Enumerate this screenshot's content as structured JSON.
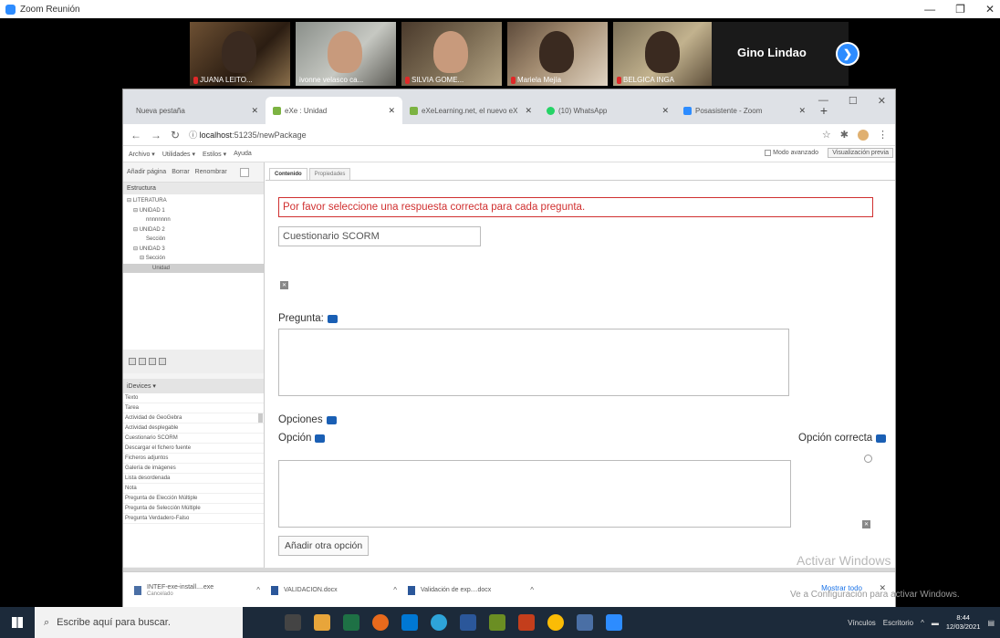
{
  "zoom": {
    "window_title": "Zoom Reunión",
    "participants": [
      {
        "name": "JUANA LEITO..."
      },
      {
        "name": "ivonne velasco ca..."
      },
      {
        "name": "SILVIA GOME..."
      },
      {
        "name": "Mariela Mejía"
      },
      {
        "name": "BELGICA INGA"
      }
    ],
    "speaker_name": "Gino Lindao",
    "next_symbol": "❯"
  },
  "browser": {
    "tabs": [
      {
        "label": "Nueva pestaña"
      },
      {
        "label": "eXe : Unidad"
      },
      {
        "label": "eXeLearning.net, el nuevo eX"
      },
      {
        "label": "(10) WhatsApp"
      },
      {
        "label": "Posasistente - Zoom"
      }
    ],
    "url_host": "localhost",
    "url_rest": ":51235/newPackage"
  },
  "exe": {
    "menu": [
      "Archivo ▾",
      "Utilidades ▾",
      "Estilos ▾",
      "Ayuda"
    ],
    "advanced_mode": "Modo avanzado",
    "preview": "Visualización previa",
    "tree_toolbar": [
      "Añadir página",
      "Borrar",
      "Renombrar"
    ],
    "structure_header": "Estructura",
    "tree": [
      {
        "label": "⊟ LITERATURA",
        "indent": 0
      },
      {
        "label": "⊟ UNIDAD 1",
        "indent": 1
      },
      {
        "label": "nnnnnnnn",
        "indent": 3
      },
      {
        "label": "⊟ UNIDAD 2",
        "indent": 1
      },
      {
        "label": "Sección",
        "indent": 3
      },
      {
        "label": "⊟ UNIDAD 3",
        "indent": 1
      },
      {
        "label": "⊟ Sección",
        "indent": 2
      },
      {
        "label": "Unidad",
        "indent": 4
      }
    ],
    "idevices_header": "iDevices ▾",
    "idevices": [
      "Texto",
      "Tarea",
      "Actividad de GeoGebra",
      "Actividad desplegable",
      "Cuestionario SCORM",
      "Descargar el fichero fuente",
      "Ficheros adjuntos",
      "Galería de imágenes",
      "Lista desordenada",
      "Nota",
      "Pregunta de Elección Múltiple",
      "Pregunta de Selección Múltiple",
      "Pregunta Verdadero-Falso"
    ],
    "content_tabs": [
      "Contenido",
      "Propiedades"
    ],
    "error_message": "Por favor seleccione una respuesta correcta para cada pregunta.",
    "title_value": "Cuestionario SCORM",
    "question_label": "Pregunta:",
    "options_label": "Opciones",
    "option_label": "Opción",
    "correct_option_label": "Opción correcta",
    "add_option": "Añadir otra opción",
    "watermark_title": "Activar Windows",
    "watermark_sub": "Ve a Configuración para activar Windows."
  },
  "downloads": {
    "items": [
      {
        "name": "INTEF-exe-install....exe",
        "status": "Cancelado"
      },
      {
        "name": "VALIDACION.docx",
        "status": ""
      },
      {
        "name": "Validación de exp....docx",
        "status": ""
      }
    ],
    "show_all": "Mostrar todo"
  },
  "taskbar": {
    "search_placeholder": "Escribe aquí para buscar.",
    "tray_links": "Vínculos",
    "tray_desktop": "Escritorio",
    "time": "8:44",
    "date": "12/03/2021"
  }
}
